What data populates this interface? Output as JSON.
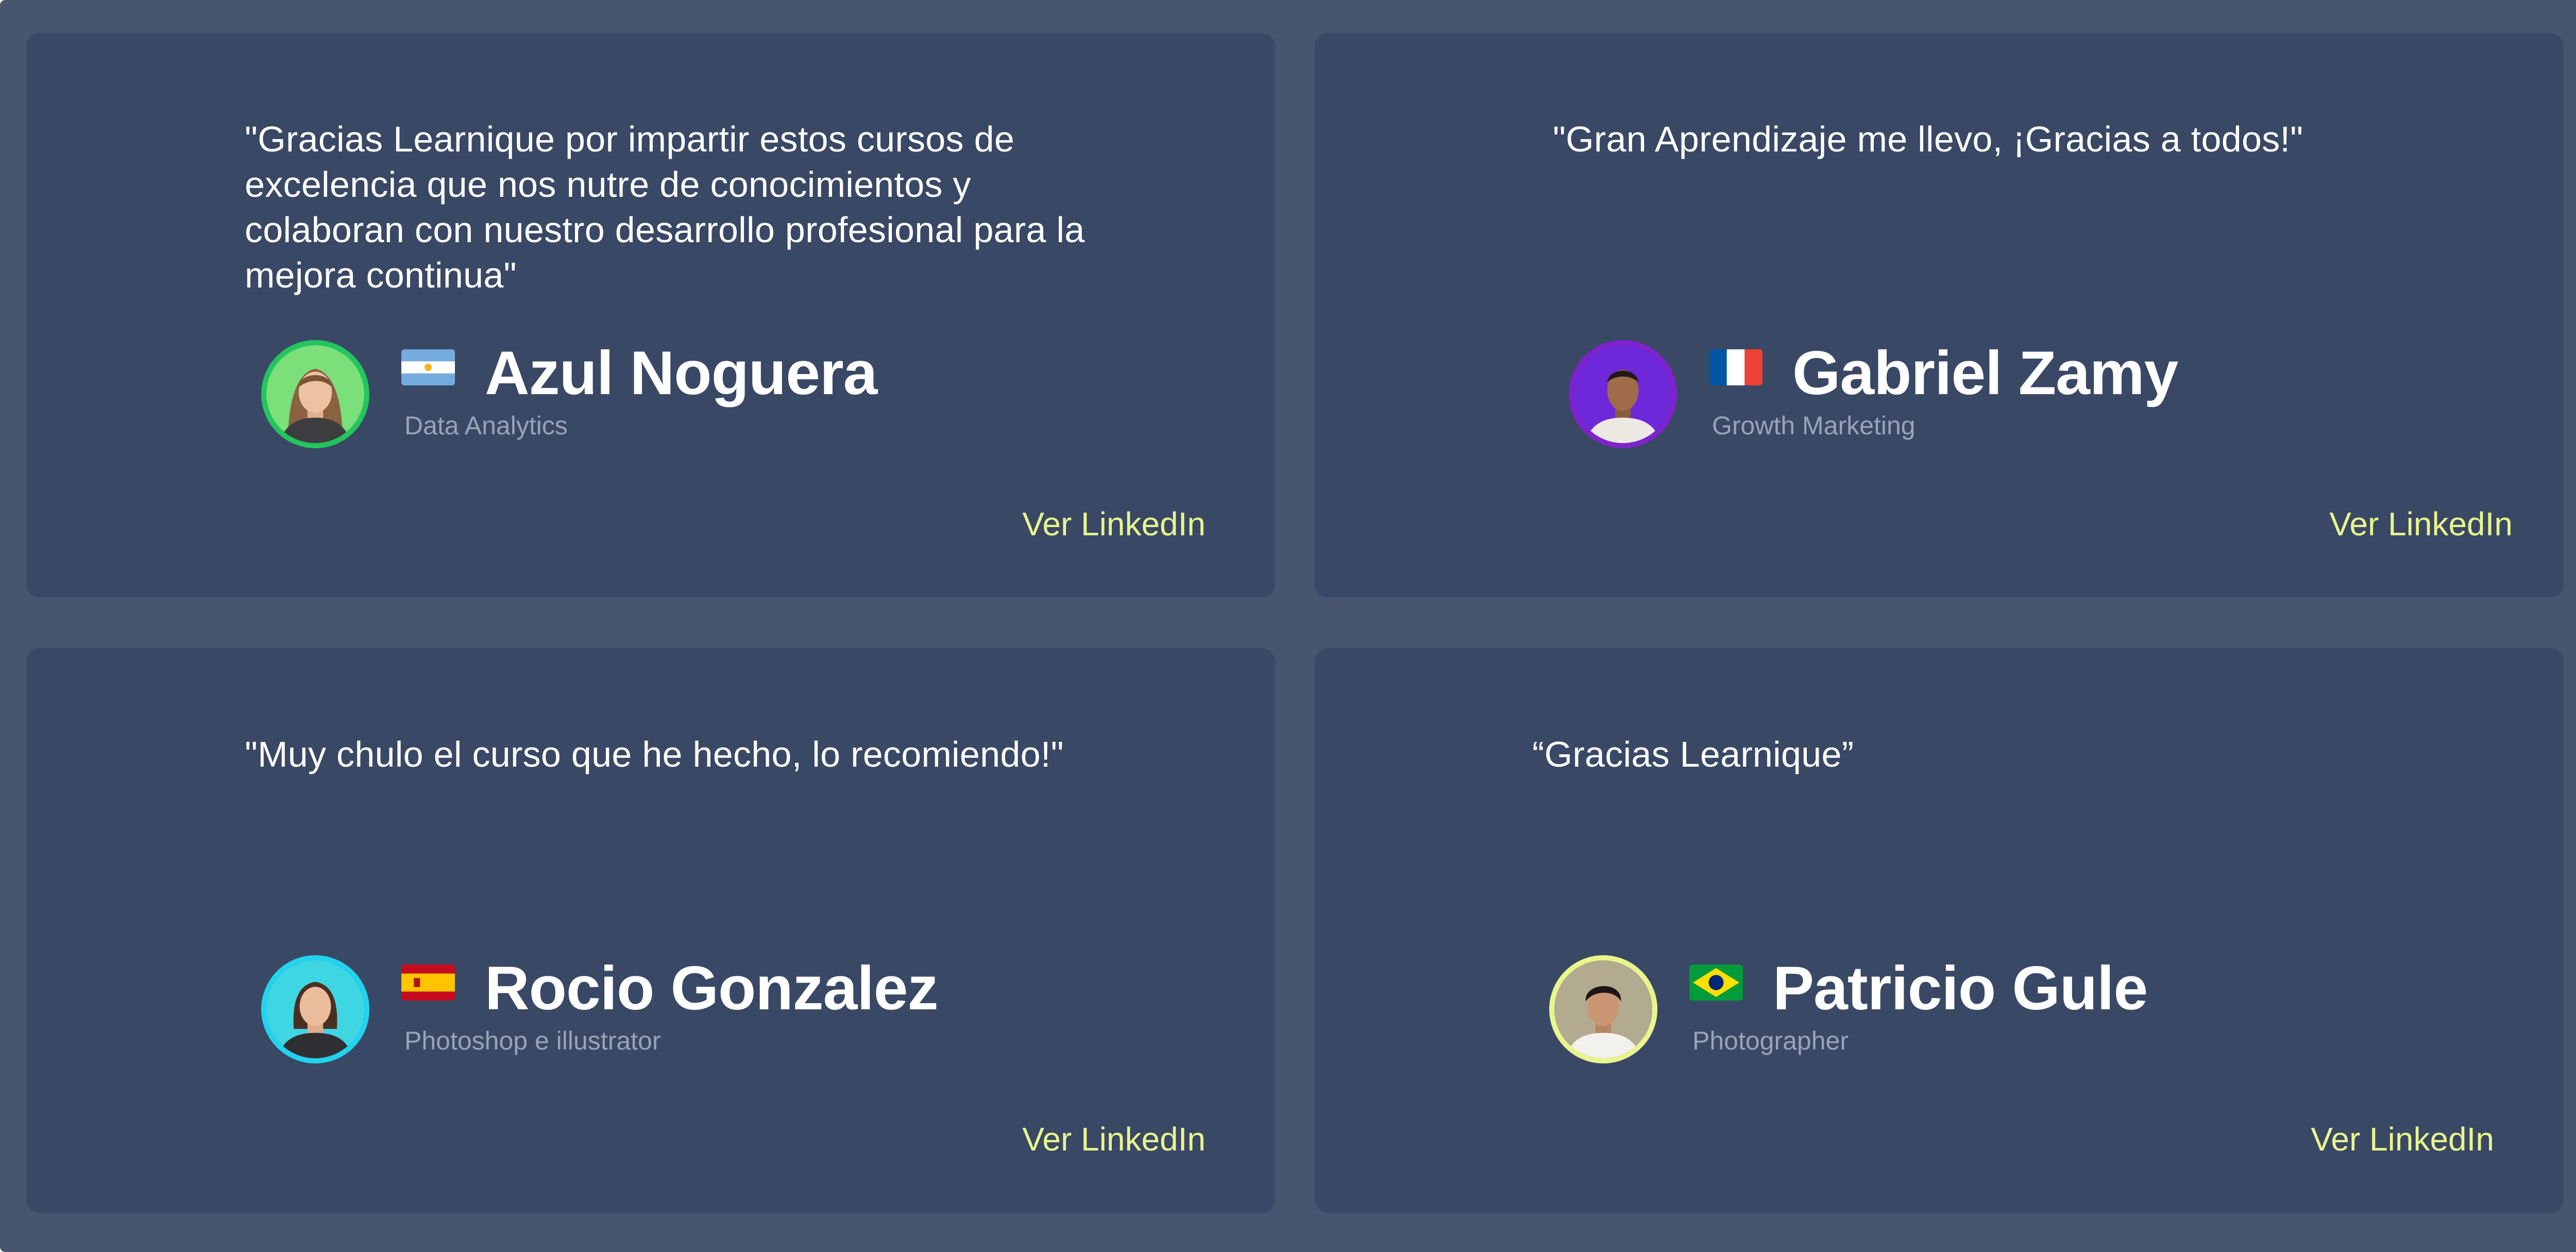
{
  "testimonials": [
    {
      "quote": "\"Gracias Learnique por impartir estos cursos de\nexcelencia que nos nutre de conocimientos y\ncolaboran con nuestro desarrollo profesional para la\nmejora continua\"",
      "name": "Azul Noguera",
      "role": "Data Analytics",
      "link_label": "Ver LinkedIn",
      "flag_icon": "argentina-flag",
      "avatar_ring_color": "#22c55e"
    },
    {
      "quote": "\"Gran Aprendizaje me llevo, ¡Gracias a todos!\"",
      "name": "Gabriel Zamy",
      "role": "Growth Marketing",
      "link_label": "Ver LinkedIn",
      "flag_icon": "france-flag",
      "avatar_ring_color": "#7e22ce"
    },
    {
      "quote": "\"Muy chulo el curso que he hecho, lo recomiendo!\"",
      "name": "Rocio Gonzalez",
      "role": "Photoshop e illustrator",
      "link_label": "Ver LinkedIn",
      "flag_icon": "spain-flag",
      "avatar_ring_color": "#22d3ee"
    },
    {
      "quote": "“Gracias Learnique”",
      "name": "Patricio Gule",
      "role": "Photographer",
      "link_label": "Ver LinkedIn",
      "flag_icon": "brazil-flag",
      "avatar_ring_color": "#e9f58c"
    }
  ],
  "colors": {
    "page_background": "#48556e",
    "card_background": "#394865",
    "text_primary": "#ffffff",
    "text_muted": "#9aa3b6",
    "link_accent": "#e9f58c"
  }
}
